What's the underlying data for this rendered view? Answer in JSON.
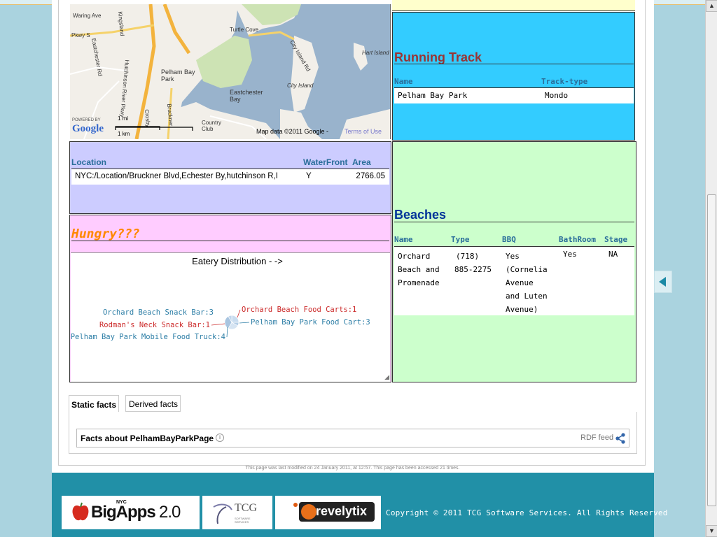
{
  "map": {
    "labels": [
      "Waring Ave",
      "Pkwy S",
      "Eastchester Rd",
      "Kingsland",
      "Turtle Cove",
      "City Island Rd",
      "Hart Island",
      "Pelham Bay Park",
      "Eastchester Bay",
      "City Island",
      "Country Club",
      "Crosby",
      "Bruckner",
      "Hutchinson River Pkwy"
    ],
    "scale_mi": "1 mi",
    "scale_km": "1 km",
    "powered_by": "POWERED BY",
    "google": "Google",
    "attribution": "Map data ©2011 Google -",
    "terms": "Terms of Use"
  },
  "running_track": {
    "title": "Running Track",
    "headers": [
      "Name",
      "Track-type"
    ],
    "rows": [
      [
        "Pelham Bay Park",
        "Mondo"
      ]
    ]
  },
  "location": {
    "headers": [
      "Location",
      "WaterFront",
      "Area"
    ],
    "rows": [
      [
        "NYC:/Location/Bruckner Blvd,Echester By,hutchinson R,I",
        "Y",
        "2766.05"
      ]
    ]
  },
  "hungry": {
    "title": "Hungry???",
    "chart_title": "Eatery Distribution - ->"
  },
  "chart_data": {
    "type": "pie",
    "title": "Eatery Distribution - ->",
    "slices": [
      {
        "label": "Orchard Beach Snack Bar:3",
        "value": 3,
        "color": "#2d7ea6"
      },
      {
        "label": "Orchard Beach Food Carts:1",
        "value": 1,
        "color": "#cc2b2b"
      },
      {
        "label": "Pelham Bay Park Food Cart:3",
        "value": 3,
        "color": "#2d7ea6"
      },
      {
        "label": "Pelham Bay Park Mobile Food Truck:4",
        "value": 4,
        "color": "#2d7ea6"
      },
      {
        "label": "Rodman's Neck Snack Bar:1",
        "value": 1,
        "color": "#cc2b2b"
      }
    ]
  },
  "beaches": {
    "title": "Beaches",
    "headers": [
      "Name",
      "Type",
      "BBQ",
      "BathRoom",
      "Stage"
    ],
    "row": {
      "name": [
        "Orchard",
        "Beach and",
        "Promenade"
      ],
      "type": [
        "(718)",
        "885-2275"
      ],
      "bbq": [
        "Yes",
        "(Cornelia",
        "Avenue",
        "and Luten",
        "Avenue)"
      ],
      "bathroom": "Yes",
      "stage": "NA"
    }
  },
  "tabs": {
    "static": "Static facts",
    "derived": "Derived facts"
  },
  "facts": {
    "title": "Facts about PelhamBayParkPage",
    "rdf": "RDF feed"
  },
  "last_modified": "This page was last modified on 24 January 2011, at 12:57. This page has been accessed 21 times.",
  "footer": {
    "bigapps_nyc": "NYC",
    "bigapps": "BigApps",
    "bigapps_ver": "2.0",
    "tcg": "TCG",
    "tcg_sub": "SOFTWARE SERVICES",
    "revelytix": "revelytix",
    "copyright": "Copyright © 2011 TCG Software Services. All Rights Reserved"
  },
  "colors": {
    "track_bg": "#33ccff",
    "location_bg": "#ccccff",
    "hungry_bg": "#ffccff",
    "beaches_bg": "#ccffcc",
    "footer_bg": "#2190a7"
  }
}
